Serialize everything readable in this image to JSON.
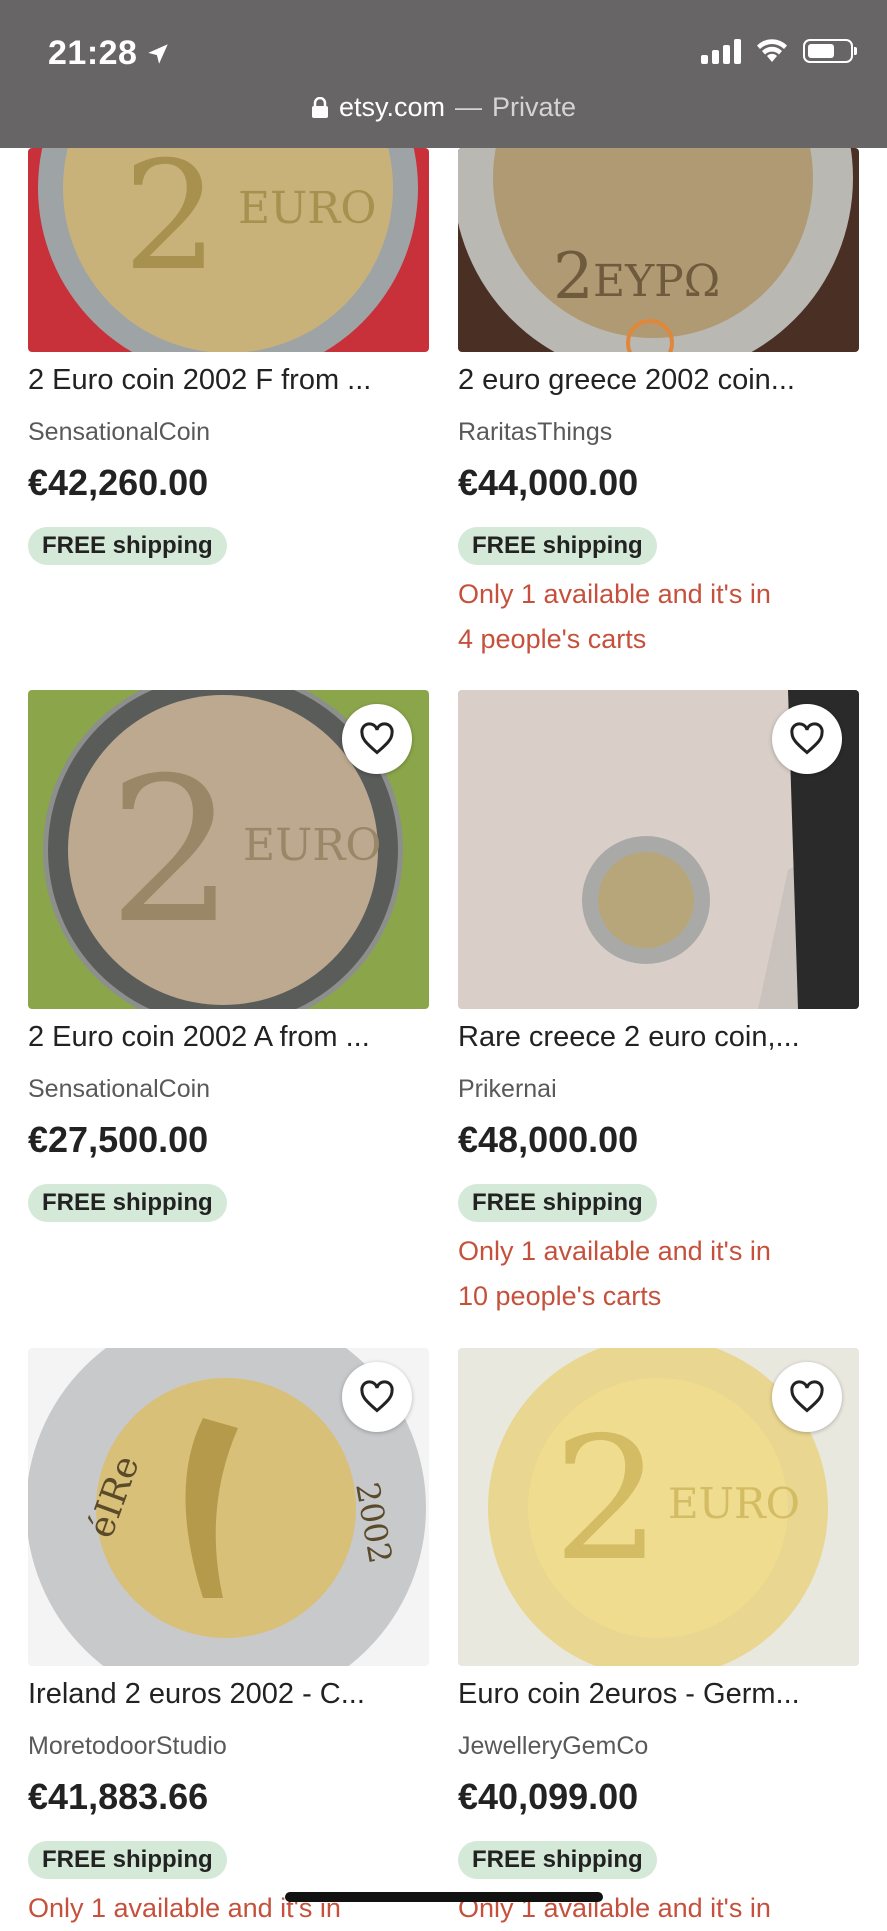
{
  "status_bar": {
    "time": "21:28"
  },
  "url_bar": {
    "domain": "etsy.com",
    "separator": "—",
    "mode": "Private"
  },
  "listings": [
    {
      "title": "2 Euro coin 2002 F from ...",
      "shop": "SensationalCoin",
      "price": "€42,260.00",
      "shipping": "FREE shipping",
      "scarcity": []
    },
    {
      "title": "2 euro greece 2002 coin...",
      "shop": "RaritasThings",
      "price": "€44,000.00",
      "shipping": "FREE shipping",
      "scarcity": [
        "Only 1 available and it's in",
        "4 people's carts"
      ]
    },
    {
      "title": "2 Euro coin 2002 A from ...",
      "shop": "SensationalCoin",
      "price": "€27,500.00",
      "shipping": "FREE shipping",
      "scarcity": []
    },
    {
      "title": "Rare creece 2 euro coin,...",
      "shop": "Prikernai",
      "price": "€48,000.00",
      "shipping": "FREE shipping",
      "scarcity": [
        "Only 1 available and it's in",
        "10 people's carts"
      ]
    },
    {
      "title": "Ireland 2 euros 2002 - C...",
      "shop": "MoretodoorStudio",
      "price": "€41,883.66",
      "shipping": "FREE shipping",
      "scarcity": [
        "Only 1 available and it's in"
      ]
    },
    {
      "title": "Euro coin 2euros - Germ...",
      "shop": "JewelleryGemCo",
      "price": "€40,099.00",
      "shipping": "FREE shipping",
      "scarcity": [
        "Only 1 available and it's in"
      ]
    }
  ],
  "coin_labels": {
    "euro": "EURO",
    "greek": "ΕΥΡΩ",
    "greek_value": "2",
    "ireland": "éIRe",
    "ireland_year": "2002"
  },
  "icons": {
    "favorite": "heart-outline-icon",
    "location": "location-arrow-icon",
    "lock": "lock-icon"
  },
  "colors": {
    "scarcity_text": "#c5513c",
    "shipping_badge": "#d4e9d7",
    "topbar": "#676566"
  }
}
